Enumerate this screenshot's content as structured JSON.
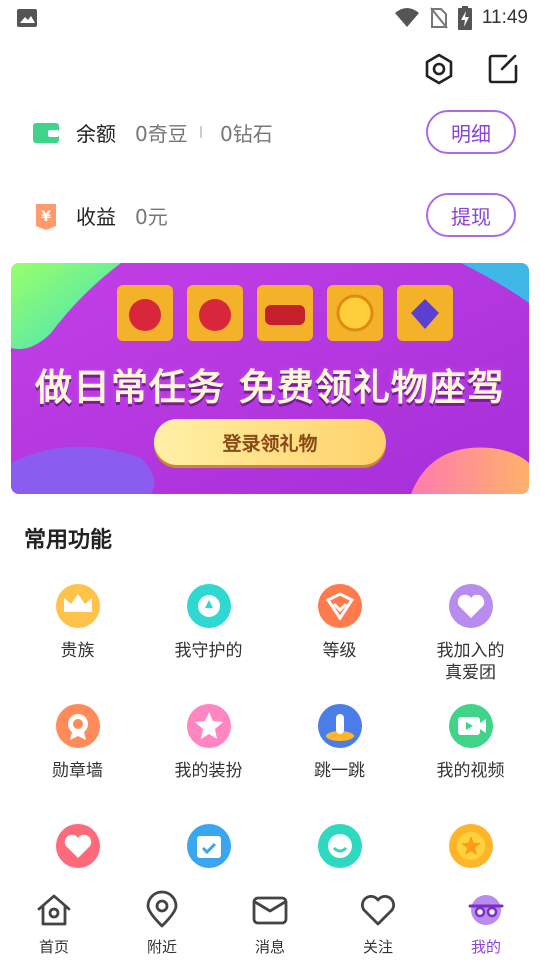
{
  "status_bar": {
    "time": "11:49"
  },
  "top_actions": {
    "settings_icon": "hexagon-settings-icon",
    "edit_icon": "edit-icon"
  },
  "balance": {
    "label": "余额",
    "beans": "0奇豆",
    "diamonds": "0钻石",
    "button": "明细"
  },
  "income": {
    "label": "收益",
    "value": "0元",
    "button": "提现"
  },
  "banner": {
    "headline": "做日常任务 免费领礼物座驾",
    "button": "登录领礼物"
  },
  "functions": {
    "title": "常用功能",
    "items": [
      {
        "label": "贵族",
        "color": "#ffc24a",
        "icon": "crown-icon"
      },
      {
        "label": "我守护的",
        "color": "#2fd8d0",
        "icon": "guard-icon"
      },
      {
        "label": "等级",
        "color": "#ff7a4d",
        "icon": "level-icon"
      },
      {
        "label": "我加入的\n真爱团",
        "color": "#b98cf0",
        "icon": "fan-club-icon"
      },
      {
        "label": "勋章墙",
        "color": "#ff8a5a",
        "icon": "medal-icon"
      },
      {
        "label": "我的装扮",
        "color": "#ff86c0",
        "icon": "dress-up-icon"
      },
      {
        "label": "跳一跳",
        "color": "#4a7de8",
        "icon": "jump-icon"
      },
      {
        "label": "我的视频",
        "color": "#3fd48a",
        "icon": "video-icon"
      },
      {
        "label": "",
        "color": "#ff6a7a",
        "icon": "heart-icon"
      },
      {
        "label": "",
        "color": "#3aa6f0",
        "icon": "calendar-icon"
      },
      {
        "label": "",
        "color": "#2fd8c0",
        "icon": "smile-icon"
      },
      {
        "label": "",
        "color": "#ffb52a",
        "icon": "star-coin-icon"
      }
    ]
  },
  "tabbar": {
    "tabs": [
      {
        "label": "首页",
        "icon": "home-icon"
      },
      {
        "label": "附近",
        "icon": "location-icon"
      },
      {
        "label": "消息",
        "icon": "message-icon"
      },
      {
        "label": "关注",
        "icon": "heart-outline-icon"
      },
      {
        "label": "我的",
        "icon": "profile-face-icon"
      }
    ],
    "active_color": "#8a43d6"
  }
}
